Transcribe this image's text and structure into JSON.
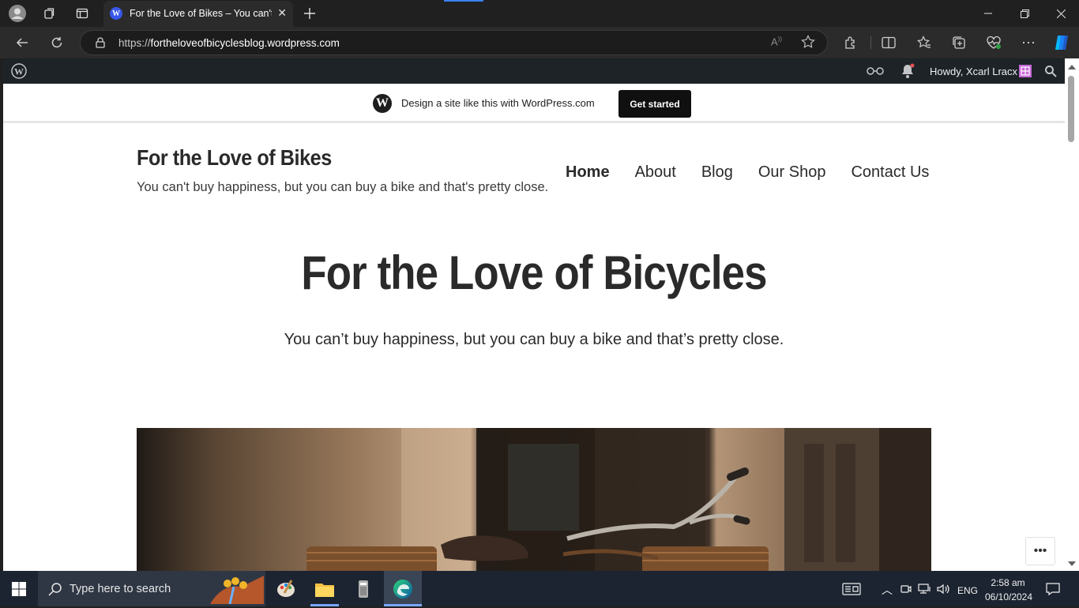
{
  "browser": {
    "tab_title": "For the Love of Bikes – You can't buy happiness",
    "url_prefix": "https://",
    "url_host": "fortheloveofbicyclesblog.wordpress.com",
    "new_tab_icon": "plus-icon"
  },
  "admin_bar": {
    "greeting": "Howdy, Xcarl Lracx"
  },
  "banner": {
    "text": "Design a site like this with WordPress.com",
    "button": "Get started"
  },
  "site": {
    "title": "For the Love of Bikes",
    "tagline": "You can't buy happiness, but you can buy a bike and that's pretty close.",
    "nav": [
      "Home",
      "About",
      "Blog",
      "Our Shop",
      "Contact Us"
    ]
  },
  "hero": {
    "title": "For the Love of Bicycles",
    "subtitle": "You can’t buy happiness, but you can buy a bike and that’s pretty close."
  },
  "taskbar": {
    "search_placeholder": "Type here to search",
    "language": "ENG",
    "time": "2:58 am",
    "date": "06/10/2024"
  }
}
